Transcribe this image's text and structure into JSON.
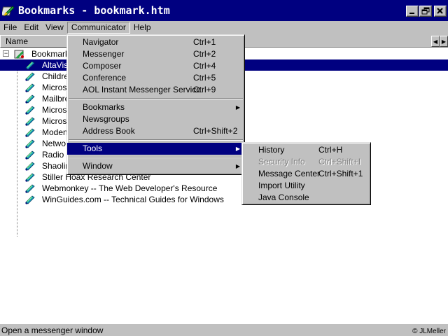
{
  "window": {
    "title": "Bookmarks - bookmark.htm"
  },
  "menubar": {
    "items": [
      "File",
      "Edit",
      "View",
      "Communicator",
      "Help"
    ]
  },
  "tree": {
    "column_header": "Name",
    "root_label": "Bookmark",
    "rows": [
      "AltaVis",
      "Childre",
      "Micros",
      "Mailbre",
      "Micros",
      "Micros",
      "Moden",
      "Netwo",
      "Radio",
      "Shaolin",
      "Stiller Hoax Research Center",
      "Webmonkey -- The Web Developer's Resource",
      "WinGuides.com -- Technical Guides for Windows"
    ]
  },
  "communicator_menu": {
    "navigator": {
      "label": "Navigator",
      "shortcut": "Ctrl+1"
    },
    "messenger": {
      "label": "Messenger",
      "shortcut": "Ctrl+2"
    },
    "composer": {
      "label": "Composer",
      "shortcut": "Ctrl+4"
    },
    "conference": {
      "label": "Conference",
      "shortcut": "Ctrl+5"
    },
    "aim": {
      "label": "AOL Instant Messenger Service",
      "shortcut": "Ctrl+9"
    },
    "bookmarks": {
      "label": "Bookmarks"
    },
    "newsgroups": {
      "label": "Newsgroups"
    },
    "address_book": {
      "label": "Address Book",
      "shortcut": "Ctrl+Shift+2"
    },
    "tools": {
      "label": "Tools"
    },
    "window": {
      "label": "Window"
    }
  },
  "tools_menu": {
    "history": {
      "label": "History",
      "shortcut": "Ctrl+H"
    },
    "security_info": {
      "label": "Security Info",
      "shortcut": "Ctrl+Shift+I"
    },
    "message_center": {
      "label": "Message Center",
      "shortcut": "Ctrl+Shift+1"
    },
    "import_utility": {
      "label": "Import Utility"
    },
    "java_console": {
      "label": "Java Console"
    }
  },
  "statusbar": {
    "text": "Open a messenger window",
    "copyright": "© JLMeller"
  },
  "colors": {
    "title_bar": "#000080",
    "selection": "#000080",
    "face": "#c0c0c0"
  }
}
